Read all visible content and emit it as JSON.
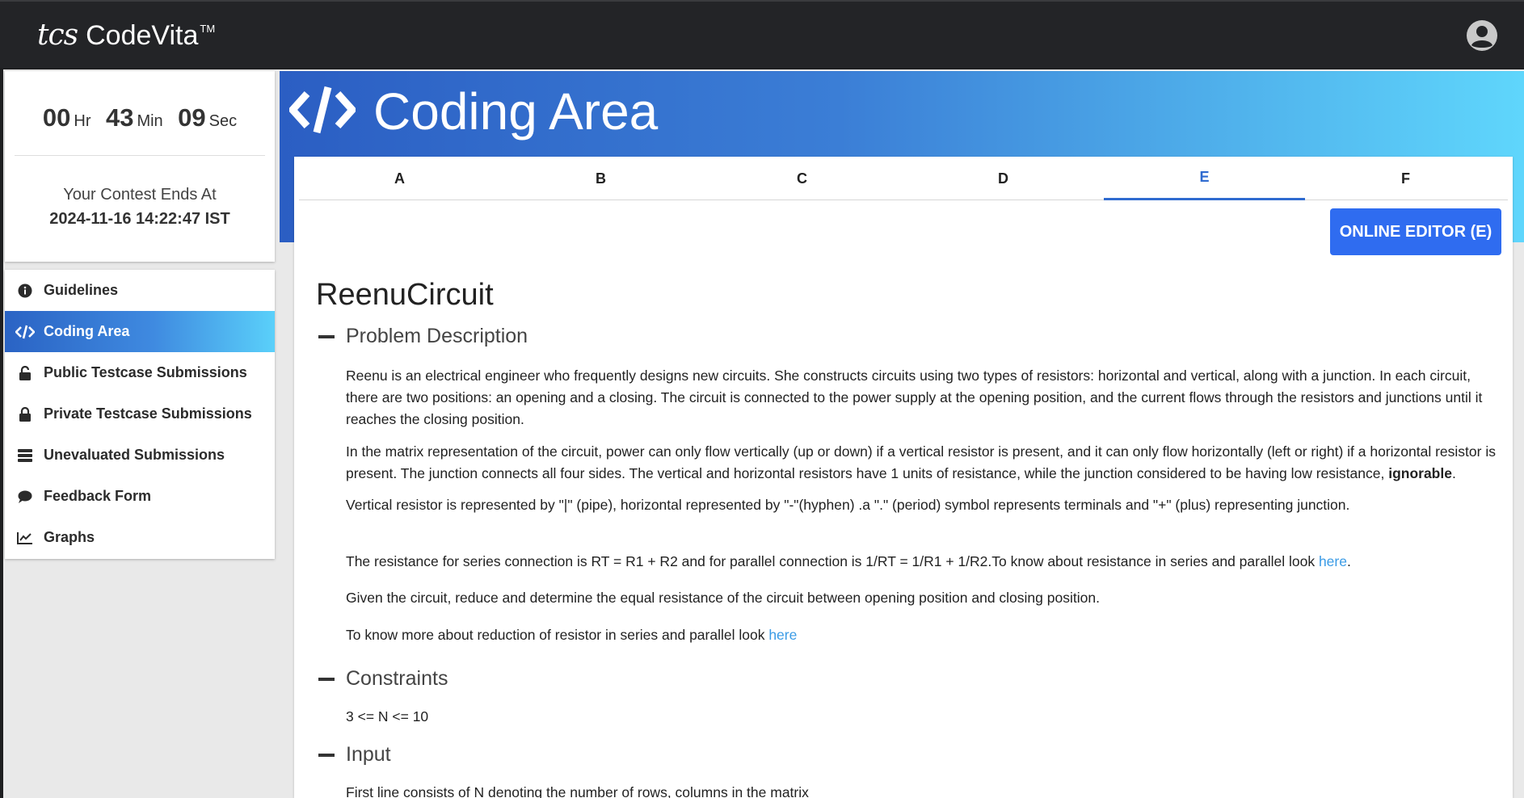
{
  "header": {
    "brand_tcs": "tcs",
    "brand_name": "CodeVita",
    "brand_tm": "TM"
  },
  "timer": {
    "hours": "00",
    "hours_unit": "Hr",
    "minutes": "43",
    "minutes_unit": "Min",
    "seconds": "09",
    "seconds_unit": "Sec",
    "ends_label": "Your Contest Ends At",
    "ends_value": "2024-11-16 14:22:47 IST"
  },
  "sidebar": {
    "items": [
      {
        "label": "Guidelines",
        "icon": "info-icon"
      },
      {
        "label": "Coding Area",
        "icon": "code-icon",
        "active": true
      },
      {
        "label": "Public Testcase Submissions",
        "icon": "lock-icon"
      },
      {
        "label": "Private Testcase Submissions",
        "icon": "lock-icon"
      },
      {
        "label": "Unevaluated Submissions",
        "icon": "list-icon"
      },
      {
        "label": "Feedback Form",
        "icon": "comment-icon"
      },
      {
        "label": "Graphs",
        "icon": "chart-icon"
      }
    ]
  },
  "banner": {
    "title": "Coding Area"
  },
  "tabs": [
    "A",
    "B",
    "C",
    "D",
    "E",
    "F"
  ],
  "active_tab": "E",
  "editor_button": "ONLINE EDITOR (E)",
  "problem": {
    "title": "ReenuCircuit",
    "sections": {
      "description": "Problem Description",
      "constraints": "Constraints",
      "input": "Input"
    },
    "p1": "Reenu is an electrical engineer who frequently designs new circuits. She constructs circuits using two types of resistors: horizontal and vertical, along with a junction. In each circuit, there are two positions: an opening and a closing. The circuit is connected to the power supply at the opening position, and the current flows through the resistors and junctions until it reaches the closing position.",
    "p2": "In the matrix representation of the circuit, power can only flow vertically (up or down) if a vertical resistor is present, and it can only flow horizontally (left or right) if a horizontal resistor is present. The junction connects all four sides. The vertical and horizontal resistors have 1 units of resistance, while the junction considered to be having low resistance, ",
    "p2_bold": "ignorable",
    "p2_end": ".",
    "p3": "Vertical resistor is represented by \"|\" (pipe), horizontal represented by \"-\"(hyphen) .a \".\" (period) symbol represents terminals and \"+\" (plus) representing junction.",
    "p4": "The resistance for series connection is RT = R1 + R2 and for parallel connection is 1/RT = 1/R1 + 1/R2.To know about resistance in series and parallel look ",
    "p4_link": "here",
    "p4_end": ".",
    "p5": "Given the circuit, reduce and determine the equal resistance of the circuit between opening position and closing position.",
    "p6": "To know more about reduction of resistor in series and parallel look ",
    "p6_link": "here",
    "constraint": "3 <= N <= 10",
    "input_line": "First line consists of N denoting the number of rows, columns in the matrix"
  }
}
